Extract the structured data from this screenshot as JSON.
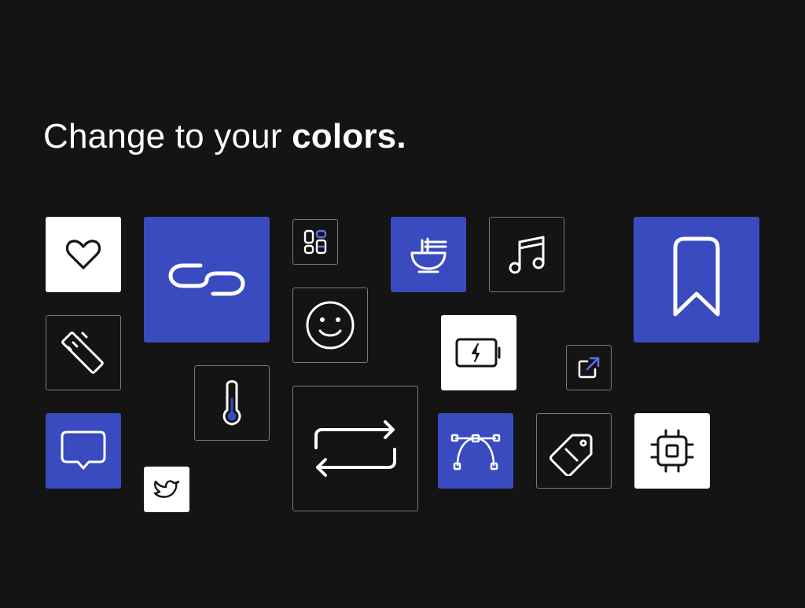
{
  "headline": {
    "regular": "Change to your ",
    "bold": "colors."
  },
  "colors": {
    "background": "#141414",
    "accent_blue": "#3a4bbf",
    "tile_white": "#ffffff",
    "tile_border": "#7a7a7a"
  },
  "icons": [
    "heart-icon",
    "link-icon",
    "dashboard-icon",
    "noodles-icon",
    "music-note-icon",
    "bookmark-icon",
    "ruler-icon",
    "smiley-icon",
    "battery-charging-icon",
    "thermometer-icon",
    "external-link-icon",
    "message-icon",
    "repeat-icon",
    "bezier-curve-icon",
    "tag-icon",
    "cpu-icon",
    "twitter-icon"
  ]
}
